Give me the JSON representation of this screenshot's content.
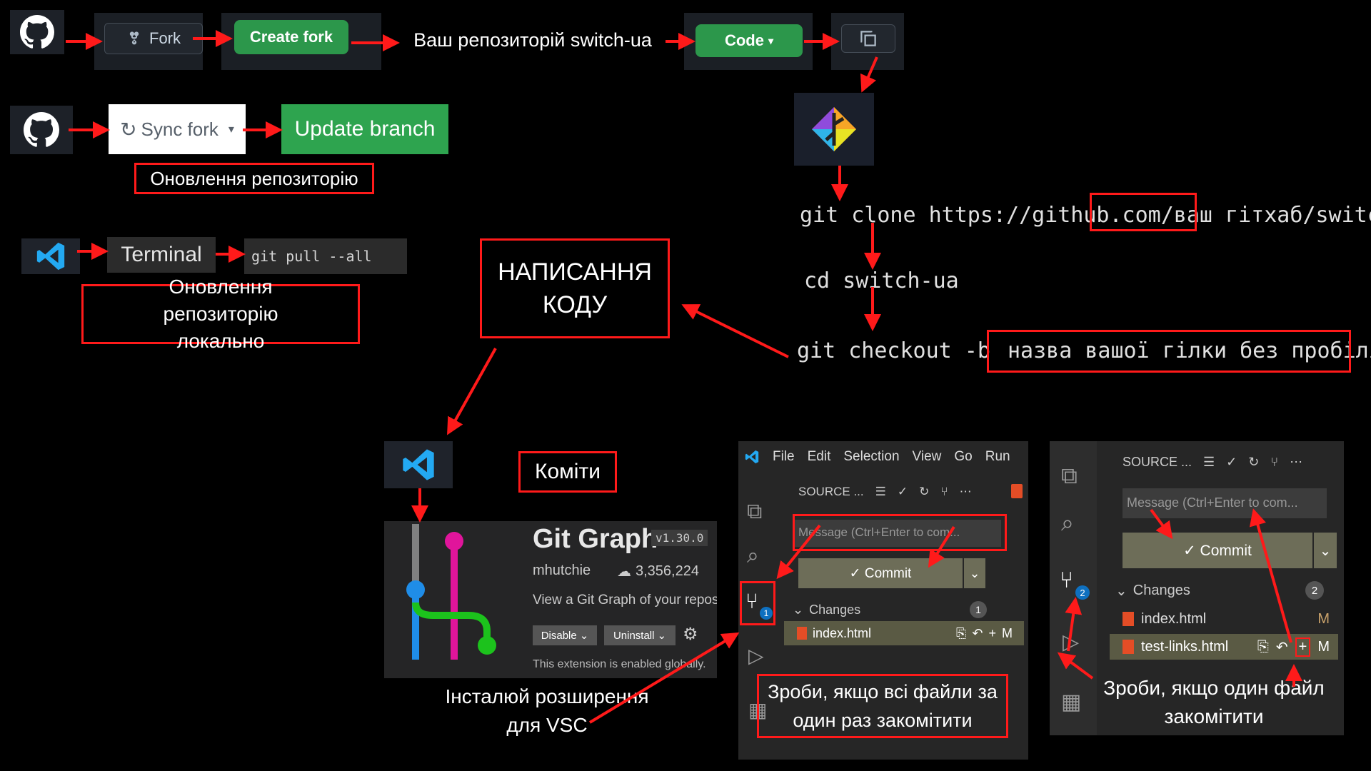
{
  "row1": {
    "fork_label": "Fork",
    "create_fork_label": "Create fork",
    "repo_text": "Ваш репозиторій switch-ua",
    "code_label": "Code"
  },
  "row2": {
    "sync_fork_label": "Sync fork",
    "update_branch_label": "Update branch",
    "caption": "Оновлення репозиторію"
  },
  "row3": {
    "terminal_label": "Terminal",
    "command": "git pull --all",
    "caption": "Оновлення репозиторію локально"
  },
  "writing_code": "НАПИСАННЯ КОДУ",
  "commands": {
    "clone_prefix": "git clone https://github.com/",
    "clone_user": "ваш гітхаб",
    "clone_suffix": "/switch-ua",
    "cd": "cd switch-ua",
    "checkout_prefix": "git checkout -b ",
    "checkout_branch": "назва вашої гілки без пробілів"
  },
  "commits_label": "Коміти",
  "extension": {
    "name": "Git Graph",
    "version": "v1.30.0",
    "author": "mhutchie",
    "installs": "3,356,224",
    "description": "View a Git Graph of your reposi",
    "disable": "Disable",
    "uninstall": "Uninstall",
    "status": "This extension is enabled globally.",
    "caption": "Інсталюй розширення для VSC"
  },
  "vsc_middle": {
    "menu": [
      "File",
      "Edit",
      "Selection",
      "View",
      "Go",
      "Run"
    ],
    "source_label": "SOURCE ...",
    "message_placeholder": "Message (Ctrl+Enter to com...",
    "commit_label": "✓ Commit",
    "changes_label": "Changes",
    "changes_count": "1",
    "scm_badge": "1",
    "file": "index.html",
    "file_status": "M",
    "caption": "Зроби, якщо всі файли за один раз закомітити"
  },
  "vsc_right": {
    "source_label": "SOURCE ...",
    "message_placeholder": "Message (Ctrl+Enter to com...",
    "commit_label": "✓ Commit",
    "changes_label": "Changes",
    "changes_count": "2",
    "scm_badge": "2",
    "file1": "index.html",
    "file2": "test-links.html",
    "file_status": "M",
    "caption": "Зроби, якщо один файл закомітити"
  },
  "colors": {
    "arrow": "#ff1a1a",
    "green": "#2c974b",
    "vscode_blue": "#23a9f2"
  }
}
